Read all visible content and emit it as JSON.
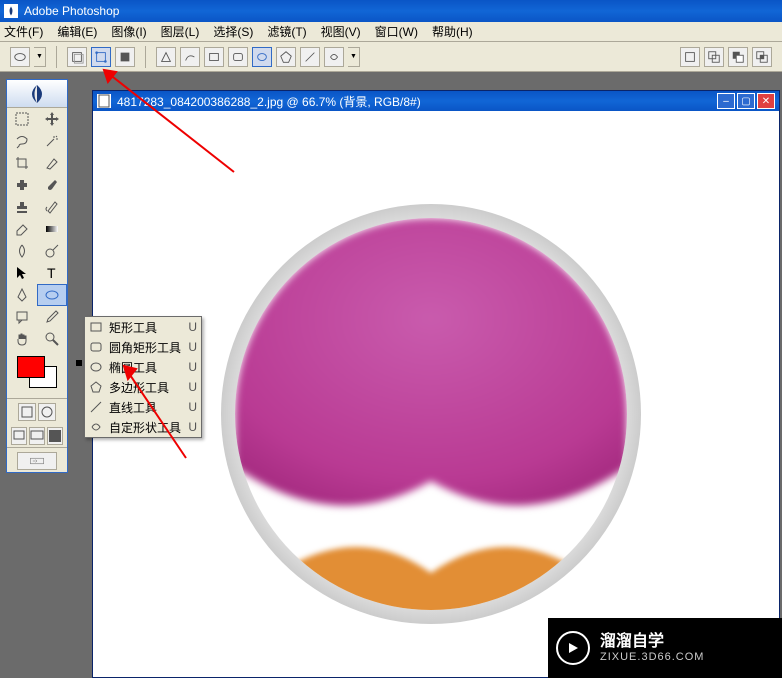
{
  "app": {
    "title": "Adobe Photoshop"
  },
  "menu": {
    "file": "文件(F)",
    "edit": "编辑(E)",
    "image": "图像(I)",
    "layer": "图层(L)",
    "select": "选择(S)",
    "filter": "滤镜(T)",
    "view": "视图(V)",
    "window": "窗口(W)",
    "help": "帮助(H)"
  },
  "doc": {
    "title": "4817283_084200386288_2.jpg @ 66.7% (背景, RGB/8#)"
  },
  "flyout": {
    "items": [
      {
        "label": "矩形工具",
        "key": "U",
        "selected": false
      },
      {
        "label": "圆角矩形工具",
        "key": "U",
        "selected": false
      },
      {
        "label": "椭圆工具",
        "key": "U",
        "selected": true
      },
      {
        "label": "多边形工具",
        "key": "U",
        "selected": false
      },
      {
        "label": "直线工具",
        "key": "U",
        "selected": false
      },
      {
        "label": "自定形状工具",
        "key": "U",
        "selected": false
      }
    ]
  },
  "colors": {
    "foreground": "#ff0000",
    "background": "#ffffff",
    "accent": "#b93a93",
    "accent2": "#e28e35"
  },
  "watermark": {
    "title": "溜溜自学",
    "sub": "ZIXUE.3D66.COM"
  }
}
